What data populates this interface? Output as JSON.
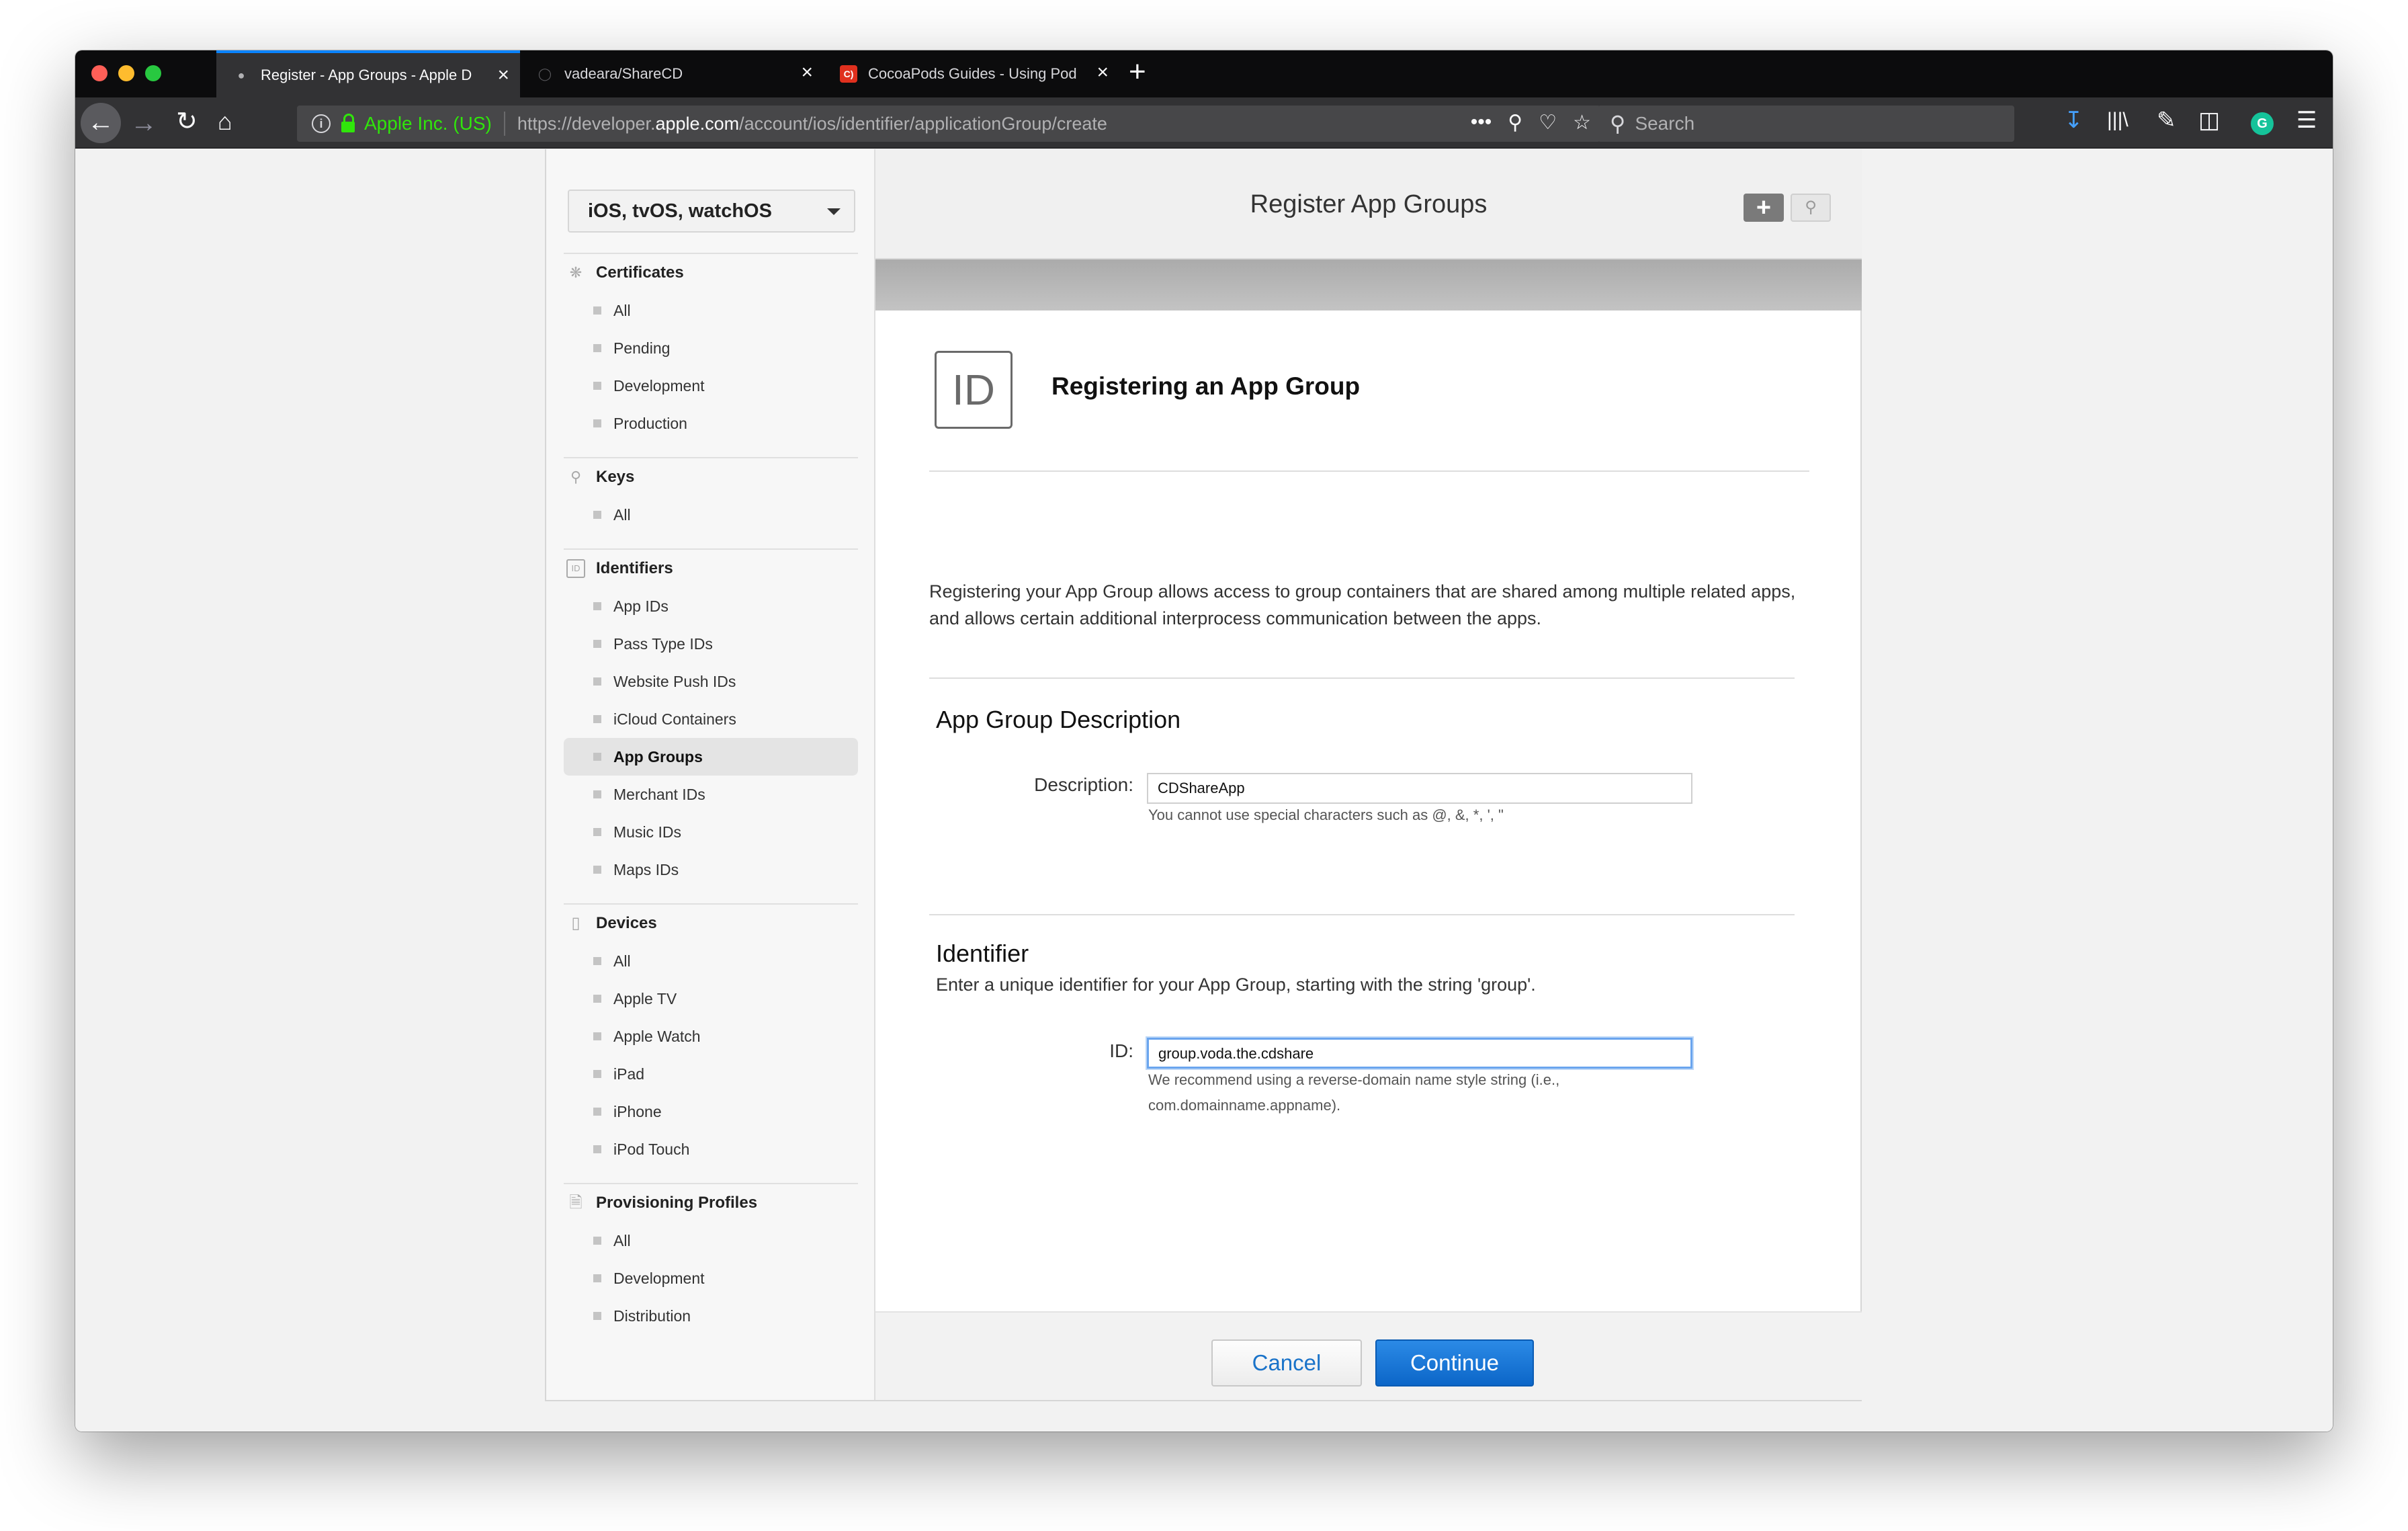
{
  "browser": {
    "tabs": [
      {
        "title": "Register - App Groups - Apple D",
        "favicon": "apple-logo-icon",
        "active": true
      },
      {
        "title": "vadeara/ShareCD",
        "favicon": "github-icon",
        "active": false
      },
      {
        "title": "CocoaPods Guides - Using Pod",
        "favicon": "cocoapods-icon",
        "active": false
      }
    ],
    "url": {
      "org": "Apple Inc. (US)",
      "prefix": "https://developer.",
      "domain": "apple.com",
      "path": "/account/ios/identifier/applicationGroup/create"
    },
    "search_placeholder": "Search",
    "accent_color": "#0a84ff"
  },
  "sidebar": {
    "platform": "iOS, tvOS, watchOS",
    "sections": [
      {
        "title": "Certificates",
        "icon": "certificate-icon",
        "items": [
          "All",
          "Pending",
          "Development",
          "Production"
        ]
      },
      {
        "title": "Keys",
        "icon": "key-icon",
        "items": [
          "All"
        ]
      },
      {
        "title": "Identifiers",
        "icon": "id-icon",
        "items": [
          "App IDs",
          "Pass Type IDs",
          "Website Push IDs",
          "iCloud Containers",
          "App Groups",
          "Merchant IDs",
          "Music IDs",
          "Maps IDs"
        ]
      },
      {
        "title": "Devices",
        "icon": "device-icon",
        "items": [
          "All",
          "Apple TV",
          "Apple Watch",
          "iPad",
          "iPhone",
          "iPod Touch"
        ]
      },
      {
        "title": "Provisioning Profiles",
        "icon": "document-icon",
        "items": [
          "All",
          "Development",
          "Distribution"
        ]
      }
    ],
    "selected": "App Groups"
  },
  "main": {
    "header_title": "Register App Groups",
    "id_badge": "ID",
    "title": "Registering an App Group",
    "intro": "Registering your App Group allows access to group containers that are shared among multiple related apps, and allows certain additional interprocess communication between the apps.",
    "description_section": {
      "title": "App Group Description",
      "label": "Description:",
      "value": "CDShareApp",
      "hint": "You cannot use special characters such as @, &, *, ', \""
    },
    "identifier_section": {
      "title": "Identifier",
      "subtitle": "Enter a unique identifier for your App Group, starting with the string 'group'.",
      "label": "ID:",
      "value": "group.voda.the.cdshare",
      "hint": "We recommend using a reverse-domain name style string (i.e., com.domainname.appname)."
    },
    "buttons": {
      "cancel": "Cancel",
      "continue": "Continue"
    }
  }
}
